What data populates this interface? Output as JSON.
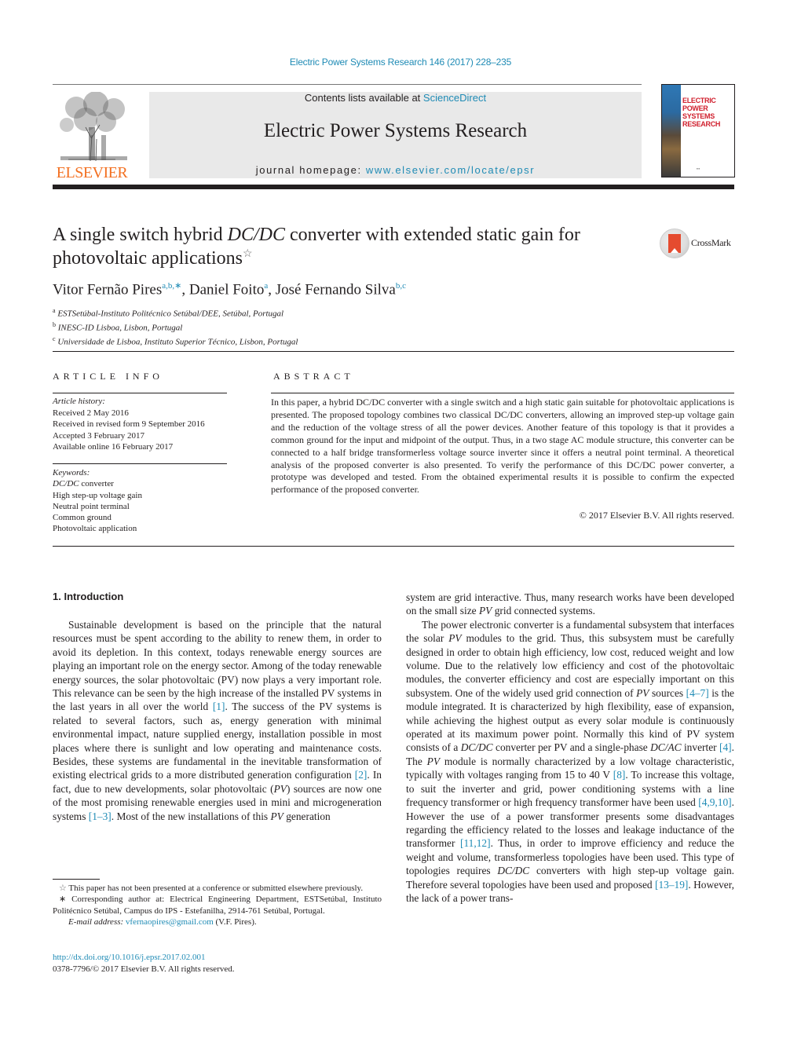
{
  "journal_ref": "Electric Power Systems Research 146 (2017) 228–235",
  "header": {
    "contents_prefix": "Contents lists available at ",
    "contents_link": "ScienceDirect",
    "journal_title": "Electric Power Systems Research",
    "homepage_prefix": "journal homepage: ",
    "homepage_link": "www.elsevier.com/locate/epsr",
    "publisher_logo_text": "ELSEVIER",
    "cover_title_line1": "ELECTRIC POWER",
    "cover_title_line2": "SYSTEMS RESEARCH"
  },
  "colors": {
    "link": "#1f8bb5",
    "elsevier_orange": "#f37021",
    "header_box": "#e9e9e9",
    "cover_title": "#d0202e"
  },
  "article": {
    "title_part1": "A single switch hybrid ",
    "title_italic": "DC/DC",
    "title_part2": " converter with extended static gain for photovoltaic applications",
    "title_mark": "☆",
    "crossmark_label": "CrossMark",
    "authors": [
      {
        "name": "Vitor Fernão Pires",
        "sup": "a,b,∗"
      },
      {
        "name": "Daniel Foito",
        "sup": "a"
      },
      {
        "name": "José Fernando Silva",
        "sup": "b,c"
      }
    ],
    "affiliations": [
      {
        "key": "a",
        "text": "ESTSetúbal-Instituto Politécnico Setúbal/DEE, Setúbal, Portugal"
      },
      {
        "key": "b",
        "text": "INESC-ID Lisboa, Lisbon, Portugal"
      },
      {
        "key": "c",
        "text": "Universidade de Lisboa, Instituto Superior Técnico, Lisbon, Portugal"
      }
    ]
  },
  "article_info": {
    "heading": "ARTICLE INFO",
    "history_label": "Article history:",
    "history": [
      "Received 2 May 2016",
      "Received in revised form 9 September 2016",
      "Accepted 3 February 2017",
      "Available online 16 February 2017"
    ],
    "keywords_label": "Keywords:",
    "keywords": [
      {
        "italic": "DC/DC",
        "text": " converter"
      },
      {
        "italic": "",
        "text": "High step-up voltage gain"
      },
      {
        "italic": "",
        "text": "Neutral point terminal"
      },
      {
        "italic": "",
        "text": "Common ground"
      },
      {
        "italic": "",
        "text": "Photovoltaic application"
      }
    ]
  },
  "abstract": {
    "heading": "ABSTRACT",
    "text": "In this paper, a hybrid DC/DC converter with a single switch and a high static gain suitable for photovoltaic applications is presented. The proposed topology combines two classical DC/DC converters, allowing an improved step-up voltage gain and the reduction of the voltage stress of all the power devices. Another feature of this topology is that it provides a common ground for the input and midpoint of the output. Thus, in a two stage AC module structure, this converter can be connected to a half bridge transformerless voltage source inverter since it offers a neutral point terminal. A theoretical analysis of the proposed converter is also presented. To verify the performance of this DC/DC power converter, a prototype was developed and tested. From the obtained experimental results it is possible to confirm the expected performance of the proposed converter.",
    "copyright": "© 2017 Elsevier B.V. All rights reserved."
  },
  "introduction": {
    "heading": "1.  Introduction",
    "left_p1_a": "Sustainable development is based on the principle that the natural resources must be spent according to the ability to renew them, in order to avoid its depletion. In this context, todays renewable energy sources are playing an important role on the energy sector. Among of the today renewable energy sources, the solar photovoltaic (PV) now plays a very important role. This relevance can be seen by the high increase of the installed PV systems in the last years in all over the world ",
    "cite1": "[1]",
    "left_p1_b": ". The success of the PV systems is related to several factors, such as, energy generation with minimal environmental impact, nature supplied energy, installation possible in most places where there is sunlight and low operating and maintenance costs. Besides, these systems are fundamental in the inevitable transformation of existing electrical grids to a more distributed generation configuration ",
    "cite2": "[2]",
    "left_p1_c": ". In fact, due to new developments, solar photovoltaic (",
    "pv": "PV",
    "left_p1_d": ") sources are now one of the most promising renewable energies used in mini and microgeneration systems ",
    "cite3": "[1–3]",
    "left_p1_e": ". Most of the new installations of this ",
    "left_p1_f": " generation",
    "right_p0_a": "system are grid interactive. Thus, many research works have been developed on the small size ",
    "right_p0_b": " grid connected systems.",
    "right_p1_a": "The power electronic converter is a fundamental subsystem that interfaces the solar ",
    "right_p1_b": " modules to the grid. Thus, this subsystem must be carefully designed in order to obtain high efficiency, low cost, reduced weight and low volume. Due to the relatively low efficiency and cost of the photovoltaic modules, the converter efficiency and cost are especially important on this subsystem. One of the widely used grid connection of ",
    "right_p1_c": " sources ",
    "cite4": "[4–7]",
    "right_p1_d": " is the module integrated. It is characterized by high flexibility, ease of expansion, while achieving the highest output as every solar module is continuously operated at its maximum power point. Normally this kind of PV system consists of a ",
    "dcdc": "DC/DC",
    "right_p1_e": " converter per PV and a single-phase ",
    "dcac": "DC/AC",
    "right_p1_f": " inverter ",
    "cite5": "[4]",
    "right_p1_g": ". The ",
    "right_p1_h": " module is normally characterized by a low voltage characteristic, typically with voltages ranging from 15 to 40 V ",
    "cite6": "[8]",
    "right_p1_i": ". To increase this voltage, to suit the inverter and grid, power conditioning systems with a line frequency transformer or high frequency transformer have been used ",
    "cite7": "[4,9,10]",
    "right_p1_j": ". However the use of a power transformer presents some disadvantages regarding the efficiency related to the losses and leakage inductance of the transformer ",
    "cite8": "[11,12]",
    "right_p1_k": ". Thus, in order to improve efficiency and reduce the weight and volume, transformerless topologies have been used. This type of topologies requires ",
    "right_p1_l": " converters with high step-up voltage gain. Therefore several topologies have been used and proposed ",
    "cite9": "[13–19]",
    "right_p1_m": ". However, the lack of a power trans-"
  },
  "footnotes": {
    "star_mark": "☆",
    "star_text": " This paper has not been presented at a conference or submitted elsewhere previously.",
    "corr_mark": "∗",
    "corr_text": " Corresponding author at: Electrical Engineering Department, ESTSetúbal, Instituto Politécnico Setúbal, Campus do IPS - Estefanilha, 2914-761 Setúbal, Portugal.",
    "email_label": "E-mail address: ",
    "email": "vfernaopires@gmail.com",
    "email_suffix": " (V.F. Pires).",
    "doi": "http://dx.doi.org/10.1016/j.epsr.2017.02.001",
    "issn": "0378-7796/© 2017 Elsevier B.V. All rights reserved."
  }
}
